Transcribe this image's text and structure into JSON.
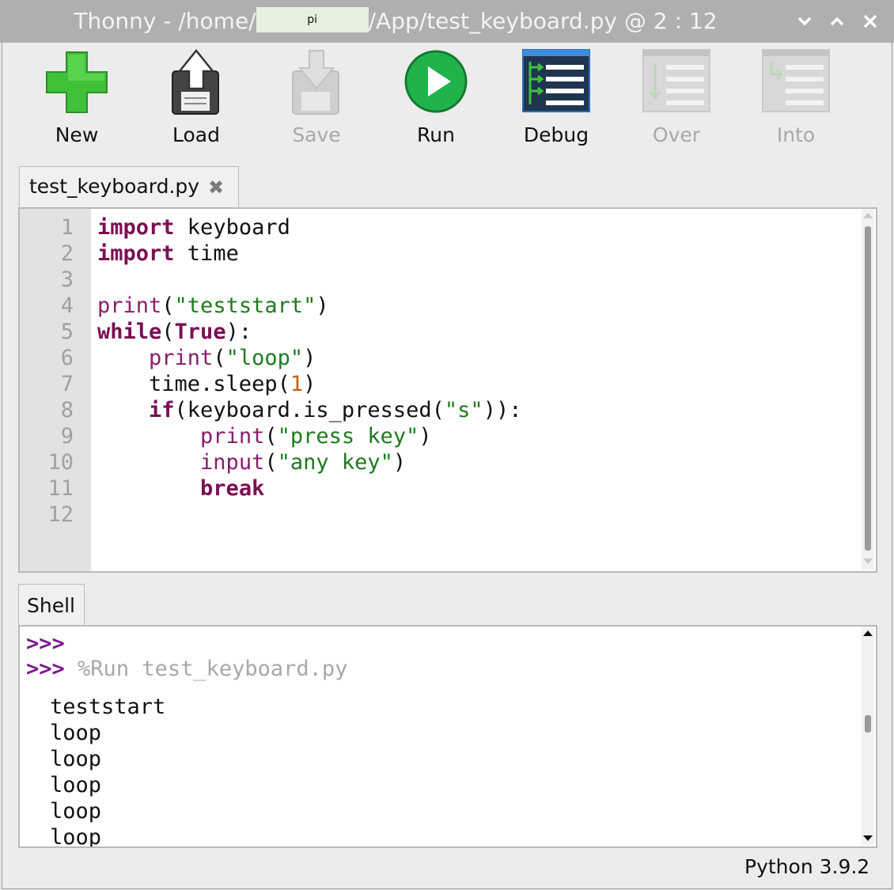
{
  "window": {
    "title_prefix": "Thonny  -  /home/",
    "user_mask": "pi",
    "title_suffix": "/App/test_keyboard.py  @  2 : 12",
    "buttons": [
      "minimize",
      "maximize",
      "close"
    ]
  },
  "toolbar": {
    "new": "New",
    "load": "Load",
    "save": "Save",
    "run": "Run",
    "debug": "Debug",
    "over": "Over",
    "into": "Into"
  },
  "editor": {
    "tab_label": "test_keyboard.py",
    "tab_close": "✖",
    "line_numbers": [
      "1",
      "2",
      "3",
      "4",
      "5",
      "6",
      "7",
      "8",
      "9",
      "10",
      "11",
      "12"
    ]
  },
  "code_lines": [
    [
      {
        "t": "import",
        "c": "kw"
      },
      {
        "t": " keyboard",
        "c": ""
      }
    ],
    [
      {
        "t": "import",
        "c": "kw"
      },
      {
        "t": " time",
        "c": ""
      }
    ],
    [],
    [
      {
        "t": "print",
        "c": "fn"
      },
      {
        "t": "(",
        "c": ""
      },
      {
        "t": "\"teststart\"",
        "c": "str"
      },
      {
        "t": ")",
        "c": ""
      }
    ],
    [
      {
        "t": "while",
        "c": "kw"
      },
      {
        "t": "(",
        "c": ""
      },
      {
        "t": "True",
        "c": "kw"
      },
      {
        "t": "):",
        "c": ""
      }
    ],
    [
      {
        "t": "    ",
        "c": ""
      },
      {
        "t": "print",
        "c": "fn"
      },
      {
        "t": "(",
        "c": ""
      },
      {
        "t": "\"loop\"",
        "c": "str"
      },
      {
        "t": ")",
        "c": ""
      }
    ],
    [
      {
        "t": "    time.sleep(",
        "c": ""
      },
      {
        "t": "1",
        "c": "num"
      },
      {
        "t": ")",
        "c": ""
      }
    ],
    [
      {
        "t": "    ",
        "c": ""
      },
      {
        "t": "if",
        "c": "kw"
      },
      {
        "t": "(keyboard.is_pressed(",
        "c": ""
      },
      {
        "t": "\"s\"",
        "c": "str"
      },
      {
        "t": ")):",
        "c": ""
      }
    ],
    [
      {
        "t": "        ",
        "c": ""
      },
      {
        "t": "print",
        "c": "fn"
      },
      {
        "t": "(",
        "c": ""
      },
      {
        "t": "\"press key\"",
        "c": "str"
      },
      {
        "t": ")",
        "c": ""
      }
    ],
    [
      {
        "t": "        ",
        "c": ""
      },
      {
        "t": "input",
        "c": "fn"
      },
      {
        "t": "(",
        "c": ""
      },
      {
        "t": "\"any key\"",
        "c": "str"
      },
      {
        "t": ")",
        "c": ""
      }
    ],
    [
      {
        "t": "        ",
        "c": ""
      },
      {
        "t": "break",
        "c": "kw"
      }
    ],
    []
  ],
  "shell": {
    "tab_label": "Shell",
    "prompt": ">>>",
    "command": "%Run test_keyboard.py",
    "output": [
      "teststart",
      "loop",
      "loop",
      "loop",
      "loop",
      "loop"
    ]
  },
  "status": {
    "python_version": "Python 3.9.2"
  },
  "colors": {
    "keyword": "#7a0f52",
    "builtin": "#8a1d6a",
    "string": "#1f7a1f",
    "number": "#c06010",
    "prompt": "#7a1a8a"
  }
}
